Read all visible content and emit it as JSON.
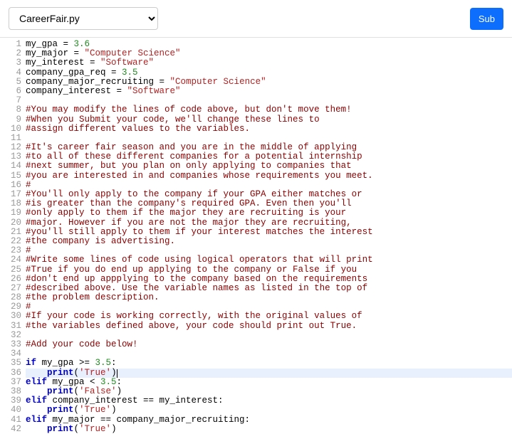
{
  "topbar": {
    "filename": "CareerFair.py",
    "submit_label": "Sub"
  },
  "code": {
    "lines": [
      {
        "n": 1,
        "hl": false,
        "segs": [
          {
            "c": "pln",
            "t": "my_gpa = "
          },
          {
            "c": "num",
            "t": "3.6"
          }
        ]
      },
      {
        "n": 2,
        "hl": false,
        "segs": [
          {
            "c": "pln",
            "t": "my_major = "
          },
          {
            "c": "str",
            "t": "\"Computer Science\""
          }
        ]
      },
      {
        "n": 3,
        "hl": false,
        "segs": [
          {
            "c": "pln",
            "t": "my_interest = "
          },
          {
            "c": "str",
            "t": "\"Software\""
          }
        ]
      },
      {
        "n": 4,
        "hl": false,
        "segs": [
          {
            "c": "pln",
            "t": "company_gpa_req = "
          },
          {
            "c": "num",
            "t": "3.5"
          }
        ]
      },
      {
        "n": 5,
        "hl": false,
        "segs": [
          {
            "c": "pln",
            "t": "company_major_recruiting = "
          },
          {
            "c": "str",
            "t": "\"Computer Science\""
          }
        ]
      },
      {
        "n": 6,
        "hl": false,
        "segs": [
          {
            "c": "pln",
            "t": "company_interest = "
          },
          {
            "c": "str",
            "t": "\"Software\""
          }
        ]
      },
      {
        "n": 7,
        "hl": false,
        "segs": []
      },
      {
        "n": 8,
        "hl": false,
        "segs": [
          {
            "c": "com",
            "t": "#You may modify the lines of code above, but don't move them!"
          }
        ]
      },
      {
        "n": 9,
        "hl": false,
        "segs": [
          {
            "c": "com",
            "t": "#When you Submit your code, we'll change these lines to"
          }
        ]
      },
      {
        "n": 10,
        "hl": false,
        "segs": [
          {
            "c": "com",
            "t": "#assign different values to the variables."
          }
        ]
      },
      {
        "n": 11,
        "hl": false,
        "segs": []
      },
      {
        "n": 12,
        "hl": false,
        "segs": [
          {
            "c": "com",
            "t": "#It's career fair season and you are in the middle of applying"
          }
        ]
      },
      {
        "n": 13,
        "hl": false,
        "segs": [
          {
            "c": "com",
            "t": "#to all of these different companies for a potential internship"
          }
        ]
      },
      {
        "n": 14,
        "hl": false,
        "segs": [
          {
            "c": "com",
            "t": "#next summer, but you plan on only applying to companies that"
          }
        ]
      },
      {
        "n": 15,
        "hl": false,
        "segs": [
          {
            "c": "com",
            "t": "#you are interested in and companies whose requirements you meet."
          }
        ]
      },
      {
        "n": 16,
        "hl": false,
        "segs": [
          {
            "c": "com",
            "t": "#"
          }
        ]
      },
      {
        "n": 17,
        "hl": false,
        "segs": [
          {
            "c": "com",
            "t": "#You'll only apply to the company if your GPA either matches or"
          }
        ]
      },
      {
        "n": 18,
        "hl": false,
        "segs": [
          {
            "c": "com",
            "t": "#is greater than the company's required GPA. Even then you'll"
          }
        ]
      },
      {
        "n": 19,
        "hl": false,
        "segs": [
          {
            "c": "com",
            "t": "#only apply to them if the major they are recruiting is your"
          }
        ]
      },
      {
        "n": 20,
        "hl": false,
        "segs": [
          {
            "c": "com",
            "t": "#major. However if you are not the major they are recruiting,"
          }
        ]
      },
      {
        "n": 21,
        "hl": false,
        "segs": [
          {
            "c": "com",
            "t": "#you'll still apply to them if your interest matches the interest"
          }
        ]
      },
      {
        "n": 22,
        "hl": false,
        "segs": [
          {
            "c": "com",
            "t": "#the company is advertising."
          }
        ]
      },
      {
        "n": 23,
        "hl": false,
        "segs": [
          {
            "c": "com",
            "t": "#"
          }
        ]
      },
      {
        "n": 24,
        "hl": false,
        "segs": [
          {
            "c": "com",
            "t": "#Write some lines of code using logical operators that will print"
          }
        ]
      },
      {
        "n": 25,
        "hl": false,
        "segs": [
          {
            "c": "com",
            "t": "#True if you do end up applying to the company or False if you"
          }
        ]
      },
      {
        "n": 26,
        "hl": false,
        "segs": [
          {
            "c": "com",
            "t": "#don't end up appplying to the company based on the requirements"
          }
        ]
      },
      {
        "n": 27,
        "hl": false,
        "segs": [
          {
            "c": "com",
            "t": "#described above. Use the variable names as listed in the top of"
          }
        ]
      },
      {
        "n": 28,
        "hl": false,
        "segs": [
          {
            "c": "com",
            "t": "#the problem description."
          }
        ]
      },
      {
        "n": 29,
        "hl": false,
        "segs": [
          {
            "c": "com",
            "t": "#"
          }
        ]
      },
      {
        "n": 30,
        "hl": false,
        "segs": [
          {
            "c": "com",
            "t": "#If your code is working correctly, with the original values of"
          }
        ]
      },
      {
        "n": 31,
        "hl": false,
        "segs": [
          {
            "c": "com",
            "t": "#the variables defined above, your code should print out True."
          }
        ]
      },
      {
        "n": 32,
        "hl": false,
        "segs": []
      },
      {
        "n": 33,
        "hl": false,
        "segs": [
          {
            "c": "com",
            "t": "#Add your code below!"
          }
        ]
      },
      {
        "n": 34,
        "hl": false,
        "segs": []
      },
      {
        "n": 35,
        "hl": false,
        "segs": [
          {
            "c": "kwd",
            "t": "if"
          },
          {
            "c": "pln",
            "t": " my_gpa >= "
          },
          {
            "c": "num",
            "t": "3.5"
          },
          {
            "c": "pln",
            "t": ":"
          }
        ]
      },
      {
        "n": 36,
        "hl": true,
        "segs": [
          {
            "c": "pln",
            "t": "    "
          },
          {
            "c": "kwd",
            "t": "print"
          },
          {
            "c": "pln",
            "t": "("
          },
          {
            "c": "str",
            "t": "'True'"
          },
          {
            "c": "pln",
            "t": ")"
          },
          {
            "c": "cursor",
            "t": ""
          }
        ]
      },
      {
        "n": 37,
        "hl": false,
        "segs": [
          {
            "c": "kwd",
            "t": "elif"
          },
          {
            "c": "pln",
            "t": " my_gpa < "
          },
          {
            "c": "num",
            "t": "3.5"
          },
          {
            "c": "pln",
            "t": ":"
          }
        ]
      },
      {
        "n": 38,
        "hl": false,
        "segs": [
          {
            "c": "pln",
            "t": "    "
          },
          {
            "c": "kwd",
            "t": "print"
          },
          {
            "c": "pln",
            "t": "("
          },
          {
            "c": "str",
            "t": "'False'"
          },
          {
            "c": "pln",
            "t": ")"
          }
        ]
      },
      {
        "n": 39,
        "hl": false,
        "segs": [
          {
            "c": "kwd",
            "t": "elif"
          },
          {
            "c": "pln",
            "t": " company_interest == my_interest:"
          }
        ]
      },
      {
        "n": 40,
        "hl": false,
        "segs": [
          {
            "c": "pln",
            "t": "    "
          },
          {
            "c": "kwd",
            "t": "print"
          },
          {
            "c": "pln",
            "t": "("
          },
          {
            "c": "str",
            "t": "'True'"
          },
          {
            "c": "pln",
            "t": ")"
          }
        ]
      },
      {
        "n": 41,
        "hl": false,
        "segs": [
          {
            "c": "kwd",
            "t": "elif"
          },
          {
            "c": "pln",
            "t": " my_major == company_major_recruiting:"
          }
        ]
      },
      {
        "n": 42,
        "hl": false,
        "segs": [
          {
            "c": "pln",
            "t": "    "
          },
          {
            "c": "kwd",
            "t": "print"
          },
          {
            "c": "pln",
            "t": "("
          },
          {
            "c": "str",
            "t": "'True'"
          },
          {
            "c": "pln",
            "t": ")"
          }
        ]
      }
    ]
  }
}
